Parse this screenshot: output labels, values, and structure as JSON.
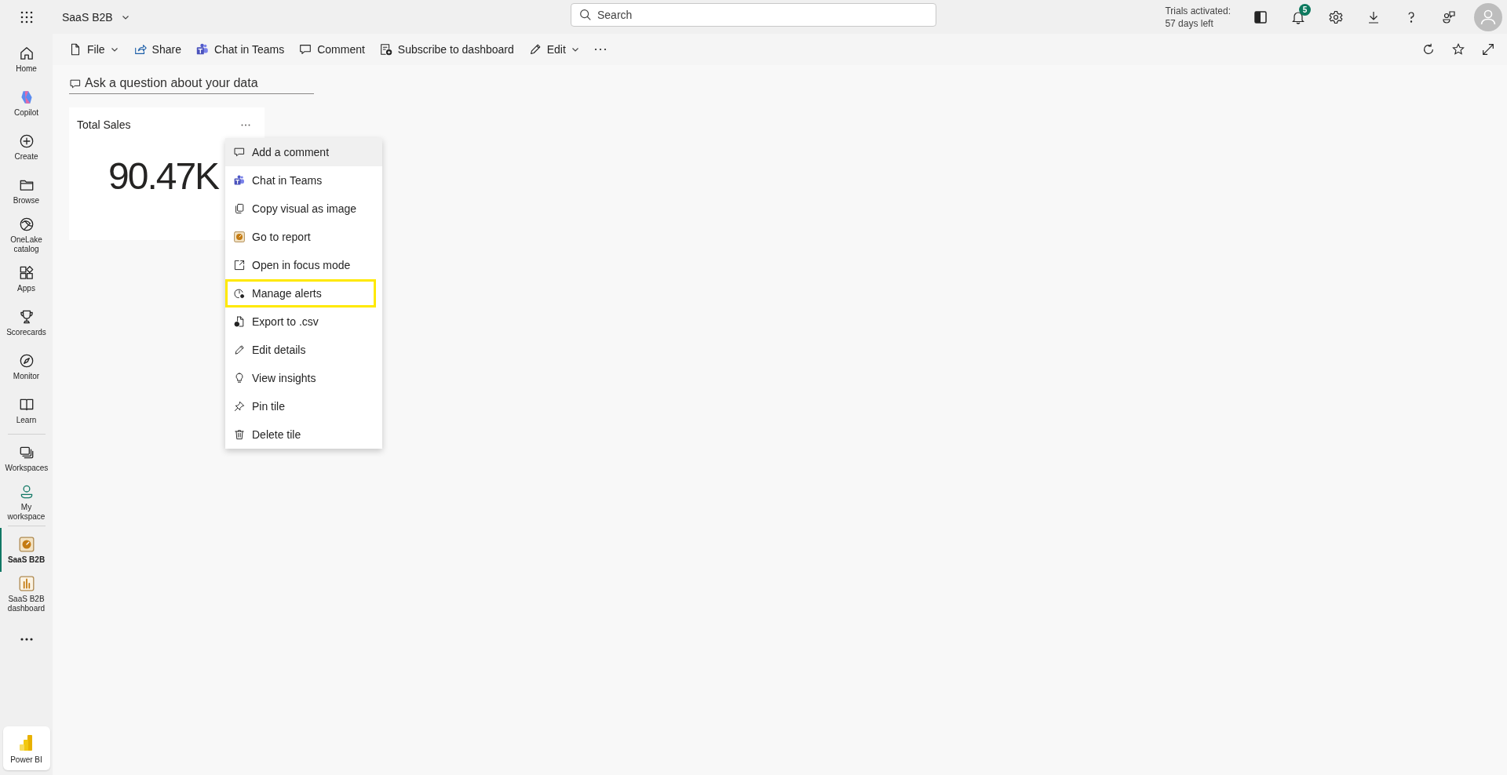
{
  "app": {
    "title": "SaaS B2B"
  },
  "search": {
    "placeholder": "Search"
  },
  "trial": {
    "line_1": "Trials activated:",
    "line_2": "57 days left"
  },
  "notifications": {
    "count": "5"
  },
  "sidebar": {
    "groups": [
      [
        {
          "label": "Home",
          "kind": "home",
          "selected": false
        },
        {
          "label": "Copilot",
          "kind": "copilot",
          "selected": false
        },
        {
          "label": "Create",
          "kind": "create",
          "selected": false
        },
        {
          "label": "Browse",
          "kind": "browse",
          "selected": false
        },
        {
          "label": "OneLake catalog",
          "kind": "onelake",
          "selected": false
        },
        {
          "label": "Apps",
          "kind": "apps",
          "selected": false
        },
        {
          "label": "Scorecards",
          "kind": "scorecards",
          "selected": false
        },
        {
          "label": "Monitor",
          "kind": "monitor",
          "selected": false
        },
        {
          "label": "Learn",
          "kind": "learn",
          "selected": false
        }
      ],
      [
        {
          "label": "Workspaces",
          "kind": "workspaces",
          "selected": false
        },
        {
          "label": "My workspace",
          "kind": "myworkspace",
          "selected": false
        }
      ],
      [
        {
          "label": "SaaS B2B",
          "kind": "report",
          "selected": true
        },
        {
          "label": "SaaS B2B dashboard",
          "kind": "dashboard",
          "selected": false
        }
      ]
    ],
    "footer": {
      "label": "Power BI"
    }
  },
  "toolbar": {
    "items": [
      {
        "label": "File",
        "kind": "file",
        "dropdown": true
      },
      {
        "label": "Share",
        "kind": "share",
        "dropdown": false
      },
      {
        "label": "Chat in Teams",
        "kind": "teams",
        "dropdown": false
      },
      {
        "label": "Comment",
        "kind": "comment",
        "dropdown": false
      },
      {
        "label": "Subscribe to dashboard",
        "kind": "subscribe",
        "dropdown": false
      },
      {
        "label": "Edit",
        "kind": "edit",
        "dropdown": true
      }
    ]
  },
  "qa": {
    "placeholder": "Ask a question about your data"
  },
  "tile": {
    "title": "Total Sales",
    "value": "90.47K"
  },
  "context_menu": {
    "items": [
      {
        "label": "Add a comment",
        "kind": "comment",
        "hovered": true,
        "highlighted": false
      },
      {
        "label": "Chat in Teams",
        "kind": "teams",
        "hovered": false,
        "highlighted": false
      },
      {
        "label": "Copy visual as image",
        "kind": "copy",
        "hovered": false,
        "highlighted": false
      },
      {
        "label": "Go to report",
        "kind": "report",
        "hovered": false,
        "highlighted": false
      },
      {
        "label": "Open in focus mode",
        "kind": "focus",
        "hovered": false,
        "highlighted": false
      },
      {
        "label": "Manage alerts",
        "kind": "alerts",
        "hovered": false,
        "highlighted": true
      },
      {
        "label": "Export to .csv",
        "kind": "export",
        "hovered": false,
        "highlighted": false
      },
      {
        "label": "Edit details",
        "kind": "edit",
        "hovered": false,
        "highlighted": false
      },
      {
        "label": "View insights",
        "kind": "insights",
        "hovered": false,
        "highlighted": false
      },
      {
        "label": "Pin tile",
        "kind": "pin",
        "hovered": false,
        "highlighted": false
      },
      {
        "label": "Delete tile",
        "kind": "delete",
        "hovered": false,
        "highlighted": false
      }
    ]
  }
}
